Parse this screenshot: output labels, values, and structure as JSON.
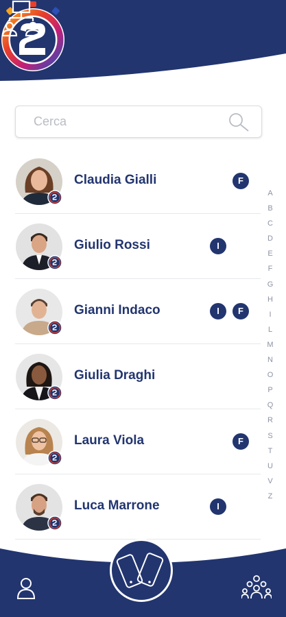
{
  "header": {
    "menu_icon": "hamburger-menu-icon",
    "team_icon": "team-hierarchy-icon",
    "logo_icon": "app-logo-2-stopwatch",
    "color_primary": "#22356f"
  },
  "search": {
    "placeholder": "Cerca",
    "icon": "search-icon"
  },
  "contacts": [
    {
      "name": "Claudia Gialli",
      "tags": [
        "F"
      ]
    },
    {
      "name": "Giulio Rossi",
      "tags": [
        "I"
      ]
    },
    {
      "name": "Gianni Indaco",
      "tags": [
        "I",
        "F"
      ]
    },
    {
      "name": "Giulia Draghi",
      "tags": []
    },
    {
      "name": "Laura Viola",
      "tags": [
        "F"
      ]
    },
    {
      "name": "Luca Marrone",
      "tags": [
        "I"
      ]
    }
  ],
  "alphabet": [
    "A",
    "B",
    "C",
    "D",
    "E",
    "F",
    "G",
    "H",
    "I",
    "L",
    "M",
    "N",
    "O",
    "P",
    "Q",
    "R",
    "S",
    "T",
    "U",
    "V",
    "Z"
  ],
  "footer": {
    "profile_icon": "user-icon",
    "center_icon": "phones-icon",
    "group_icon": "group-icon"
  }
}
